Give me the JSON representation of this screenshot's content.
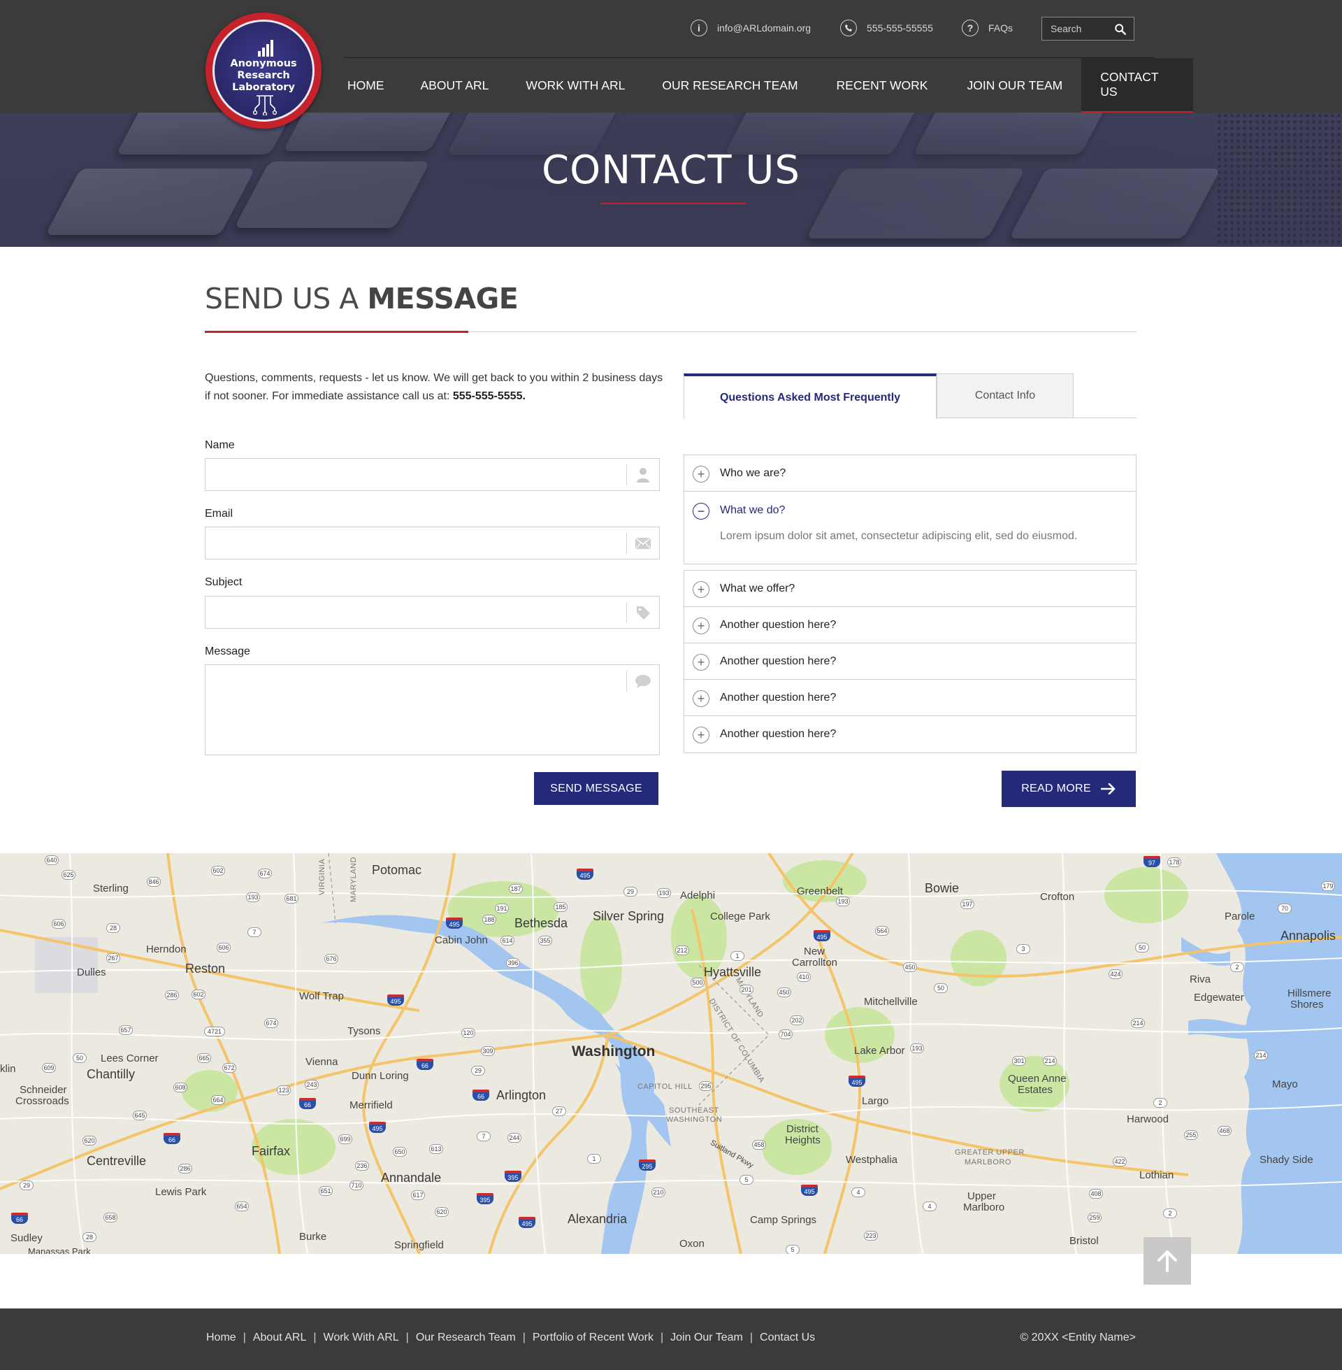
{
  "logo": {
    "line1": "Anonymous",
    "line2": "Research",
    "line3": "Laboratory"
  },
  "topbar": {
    "email": "info@ARLdomain.org",
    "phone": "555-555-55555",
    "faqs": "FAQs",
    "search_placeholder": "Search",
    "email_icon": "info-icon",
    "phone_icon": "phone-icon",
    "faqs_icon": "question-icon"
  },
  "nav": {
    "items": [
      {
        "label": "HOME"
      },
      {
        "label": "ABOUT ARL"
      },
      {
        "label": "WORK WITH ARL"
      },
      {
        "label": "OUR RESEARCH TEAM"
      },
      {
        "label": "RECENT WORK"
      },
      {
        "label": "JOIN OUR TEAM"
      },
      {
        "label": "CONTACT US",
        "active": true
      }
    ]
  },
  "hero": {
    "title": "CONTACT US"
  },
  "section": {
    "title_light": "SEND US A ",
    "title_bold": "MESSAGE"
  },
  "intro": {
    "text": "Questions, comments, requests - let us know. We will get back to you within 2 business days if not sooner. For immediate assistance call us at: ",
    "phone": "555-555-5555."
  },
  "form": {
    "name_label": "Name",
    "email_label": "Email",
    "subject_label": "Subject",
    "message_label": "Message",
    "name_value": "",
    "email_value": "",
    "subject_value": "",
    "message_value": "",
    "submit_label": "SEND MESSAGE"
  },
  "tabs": [
    {
      "label": "Questions Asked Most Frequently",
      "active": true
    },
    {
      "label": "Contact Info",
      "active": false
    }
  ],
  "faq": {
    "items": [
      {
        "question": "Who we are?"
      },
      {
        "question": "What we do?",
        "answer": "Lorem ipsum dolor sit amet, consectetur adipiscing elit, sed do eiusmod."
      },
      {
        "question": "What we offer?"
      },
      {
        "question": "Another question here?"
      },
      {
        "question": "Another question here?"
      },
      {
        "question": "Another question here?"
      },
      {
        "question": "Another question here?"
      }
    ],
    "read_more_label": "READ MORE"
  },
  "map": {
    "labels": {
      "potomac": "Potomac",
      "sterling": "Sterling",
      "herndon": "Herndon",
      "reston": "Reston",
      "dulles": "Dulles",
      "wolftrap": "Wolf Trap",
      "tysons": "Tysons",
      "vienna": "Vienna",
      "dunnloring": "Dunn Loring",
      "merrifield": "Merrifield",
      "chantilly": "Chantilly",
      "leescorner": "Lees Corner",
      "schneider": "Schneider",
      "crossroads": "Crossroads",
      "centreville": "Centreville",
      "fairfax": "Fairfax",
      "lewispark": "Lewis Park",
      "sudley": "Sudley",
      "manassaspark": "Manassas Park",
      "burke": "Burke",
      "annandale": "Annandale",
      "springfield": "Springfield",
      "alexandria": "Alexandria",
      "arlington": "Arlington",
      "washington": "Washington",
      "bethesda": "Bethesda",
      "cabinjohn": "Cabin John",
      "silverspring": "Silver Spring",
      "adelphi": "Adelphi",
      "collegepark": "College Park",
      "greenbelt": "Greenbelt",
      "hyattsville": "Hyattsville",
      "newcarrollton1": "New",
      "newcarrollton2": "Carrollton",
      "bowie": "Bowie",
      "crofton": "Crofton",
      "mitchellville": "Mitchellville",
      "lakearbor": "Lake Arbor",
      "largo": "Largo",
      "districtheights1": "District",
      "districtheights2": "Heights",
      "westphalia": "Westphalia",
      "campsprings": "Camp Springs",
      "oxon": "Oxon",
      "upper1": "Upper",
      "upper2": "Marlboro",
      "queenanne1": "Queen Anne",
      "queenanne2": "Estates",
      "harwood": "Harwood",
      "lothian": "Lothian",
      "bristol": "Bristol",
      "annapolis": "Annapolis",
      "parole": "Parole",
      "riva": "Riva",
      "edgewater": "Edgewater",
      "hillsmere1": "Hillsmere",
      "hillsmere2": "Shores",
      "mayo": "Mayo",
      "shadyside": "Shady Side",
      "capitolhill": "CAPITOL HILL",
      "southeast1": "SOUTHEAST",
      "southeast2": "WASHINGTON",
      "greaterupper1": "GREATER UPPER",
      "greaterupper2": "MARLBORO",
      "virginia": "VIRGINIA",
      "maryland": "MARYLAND",
      "dc": "DISTRICT OF COLUMBIA",
      "md2": "MARYLAND",
      "klin": "klin",
      "suitland": "Suitland Pkwy"
    },
    "shields": {
      "s640": "640",
      "s625": "625",
      "s602": "602",
      "s674": "674",
      "s846": "846",
      "s193a": "193",
      "s681": "681",
      "s606": "606",
      "s28": "28",
      "s7": "7",
      "s267": "267",
      "s676": "676",
      "s606b": "606",
      "s286": "286",
      "s602b": "602",
      "s4721": "4721",
      "s657": "657",
      "s674b": "674",
      "s50": "50",
      "s609": "609",
      "s665": "665",
      "s672": "672",
      "s608": "608",
      "s664": "664",
      "s645": "645",
      "s620": "620",
      "s286b": "286",
      "s29": "29",
      "s658": "658",
      "s28b": "28",
      "s654": "654",
      "s651": "651",
      "s710": "710",
      "s236": "236",
      "s617": "617",
      "s620b": "620",
      "s650": "650",
      "s613": "613",
      "s244": "244",
      "s7b": "7",
      "s27": "27",
      "s120": "120",
      "s309": "309",
      "s29b": "29",
      "s123": "123",
      "s243": "243",
      "s699": "699",
      "s187": "187",
      "s191": "191",
      "s188": "188",
      "s185": "185",
      "s614": "614",
      "s355": "355",
      "s396": "396",
      "s29c": "29",
      "s193b": "193",
      "s212": "212",
      "s1": "1",
      "s500": "500",
      "s201": "201",
      "s410": "410",
      "s450": "450",
      "s193c": "193",
      "s564": "564",
      "s197": "197",
      "s450b": "450",
      "s3": "3",
      "s50b": "50",
      "s424": "424",
      "s214": "214",
      "s202": "202",
      "s704": "704",
      "s193d": "193",
      "s301": "301",
      "s214b": "214",
      "s2": "2",
      "s255": "255",
      "s468": "468",
      "s422": "422",
      "s408": "408",
      "s259": "259",
      "s2b": "2",
      "s4": "4",
      "s4b": "4",
      "s223": "223",
      "s5": "5",
      "s5b": "5",
      "s458": "458",
      "s210": "210",
      "s50c": "50",
      "s70": "70",
      "s178": "178",
      "s179": "179",
      "s2c": "2",
      "s214c": "214",
      "s295": "295",
      "s1b": "1"
    },
    "interstates": {
      "i495a": "495",
      "i495b": "495",
      "i495c": "495",
      "i495d": "495",
      "i495e": "495",
      "i495f": "495",
      "i495g": "495",
      "i66a": "66",
      "i66b": "66",
      "i66c": "66",
      "i66d": "66",
      "i66e": "66",
      "i395a": "395",
      "i395b": "395",
      "i295": "295",
      "i97": "97",
      "i495h": "495"
    }
  },
  "footer": {
    "links": [
      "Home",
      "About ARL",
      "Work With ARL",
      "Our Research Team",
      "Portfolio of Recent Work",
      "Join Our Team",
      "Contact Us"
    ],
    "copyright": "© 20XX <Entity Name>"
  },
  "colors": {
    "accent": "#25297a",
    "brand_red": "#c6222b",
    "header_bg": "#3b3b3b"
  }
}
